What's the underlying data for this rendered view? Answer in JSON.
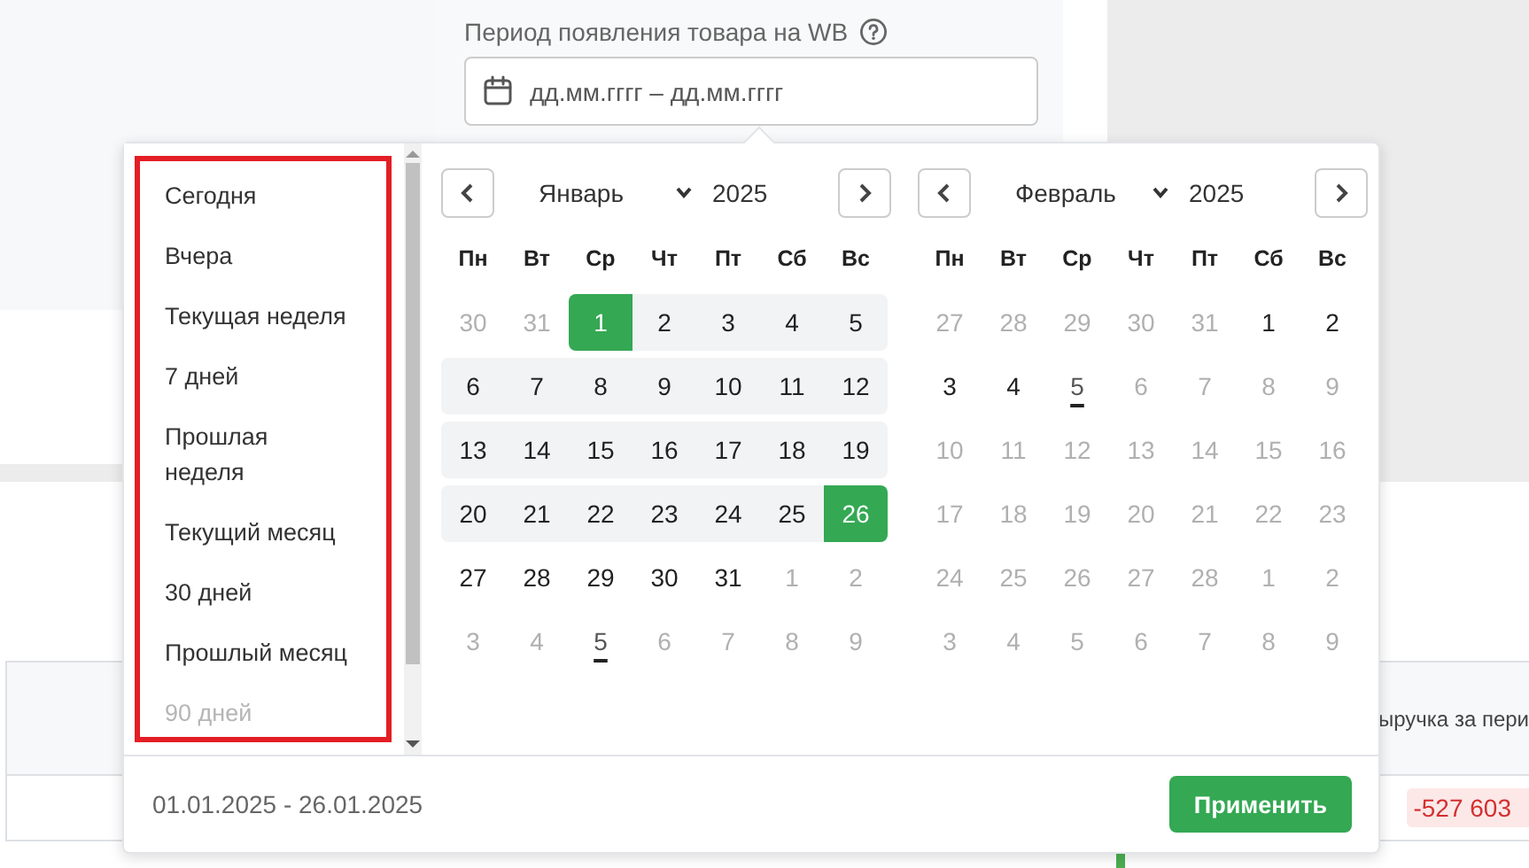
{
  "filter": {
    "label": "Период появления товара на WB",
    "field": {
      "placeholder": "дд.мм.гггг – дд.мм.гггг"
    }
  },
  "presets": [
    {
      "label": "Сегодня",
      "faded": false
    },
    {
      "label": "Вчера",
      "faded": false
    },
    {
      "label": "Текущая неделя",
      "faded": false
    },
    {
      "label": "7 дней",
      "faded": false
    },
    {
      "label": "Прошлая неделя",
      "faded": false
    },
    {
      "label": "Текущий месяц",
      "faded": false
    },
    {
      "label": "30 дней",
      "faded": false
    },
    {
      "label": "Прошлый месяц",
      "faded": false
    },
    {
      "label": "90 дней",
      "faded": true
    }
  ],
  "calendars": [
    {
      "month": "Январь",
      "year": "2025",
      "weekdays": [
        "Пн",
        "Вт",
        "Ср",
        "Чт",
        "Пт",
        "Сб",
        "Вс"
      ],
      "weeks": [
        [
          {
            "label": "30",
            "muted": true,
            "selected": false,
            "in_range": false,
            "today": false
          },
          {
            "label": "31",
            "muted": true,
            "selected": false,
            "in_range": false,
            "today": false
          },
          {
            "label": "1",
            "muted": false,
            "selected": true,
            "in_range": false,
            "today": false
          },
          {
            "label": "2",
            "muted": false,
            "selected": false,
            "in_range": true,
            "today": false
          },
          {
            "label": "3",
            "muted": false,
            "selected": false,
            "in_range": true,
            "today": false
          },
          {
            "label": "4",
            "muted": false,
            "selected": false,
            "in_range": true,
            "today": false
          },
          {
            "label": "5",
            "muted": false,
            "selected": false,
            "in_range": true,
            "today": false
          }
        ],
        [
          {
            "label": "6",
            "muted": false,
            "selected": false,
            "in_range": true,
            "today": false
          },
          {
            "label": "7",
            "muted": false,
            "selected": false,
            "in_range": true,
            "today": false
          },
          {
            "label": "8",
            "muted": false,
            "selected": false,
            "in_range": true,
            "today": false
          },
          {
            "label": "9",
            "muted": false,
            "selected": false,
            "in_range": true,
            "today": false
          },
          {
            "label": "10",
            "muted": false,
            "selected": false,
            "in_range": true,
            "today": false
          },
          {
            "label": "11",
            "muted": false,
            "selected": false,
            "in_range": true,
            "today": false
          },
          {
            "label": "12",
            "muted": false,
            "selected": false,
            "in_range": true,
            "today": false
          }
        ],
        [
          {
            "label": "13",
            "muted": false,
            "selected": false,
            "in_range": true,
            "today": false
          },
          {
            "label": "14",
            "muted": false,
            "selected": false,
            "in_range": true,
            "today": false
          },
          {
            "label": "15",
            "muted": false,
            "selected": false,
            "in_range": true,
            "today": false
          },
          {
            "label": "16",
            "muted": false,
            "selected": false,
            "in_range": true,
            "today": false
          },
          {
            "label": "17",
            "muted": false,
            "selected": false,
            "in_range": true,
            "today": false
          },
          {
            "label": "18",
            "muted": false,
            "selected": false,
            "in_range": true,
            "today": false
          },
          {
            "label": "19",
            "muted": false,
            "selected": false,
            "in_range": true,
            "today": false
          }
        ],
        [
          {
            "label": "20",
            "muted": false,
            "selected": false,
            "in_range": true,
            "today": false
          },
          {
            "label": "21",
            "muted": false,
            "selected": false,
            "in_range": true,
            "today": false
          },
          {
            "label": "22",
            "muted": false,
            "selected": false,
            "in_range": true,
            "today": false
          },
          {
            "label": "23",
            "muted": false,
            "selected": false,
            "in_range": true,
            "today": false
          },
          {
            "label": "24",
            "muted": false,
            "selected": false,
            "in_range": true,
            "today": false
          },
          {
            "label": "25",
            "muted": false,
            "selected": false,
            "in_range": true,
            "today": false
          },
          {
            "label": "26",
            "muted": false,
            "selected": true,
            "in_range": false,
            "today": false
          }
        ],
        [
          {
            "label": "27",
            "muted": false,
            "selected": false,
            "in_range": false,
            "today": false
          },
          {
            "label": "28",
            "muted": false,
            "selected": false,
            "in_range": false,
            "today": false
          },
          {
            "label": "29",
            "muted": false,
            "selected": false,
            "in_range": false,
            "today": false
          },
          {
            "label": "30",
            "muted": false,
            "selected": false,
            "in_range": false,
            "today": false
          },
          {
            "label": "31",
            "muted": false,
            "selected": false,
            "in_range": false,
            "today": false
          },
          {
            "label": "1",
            "muted": true,
            "selected": false,
            "in_range": false,
            "today": false
          },
          {
            "label": "2",
            "muted": true,
            "selected": false,
            "in_range": false,
            "today": false
          }
        ],
        [
          {
            "label": "3",
            "muted": true,
            "selected": false,
            "in_range": false,
            "today": false
          },
          {
            "label": "4",
            "muted": true,
            "selected": false,
            "in_range": false,
            "today": false
          },
          {
            "label": "5",
            "muted": true,
            "selected": false,
            "in_range": false,
            "today": true
          },
          {
            "label": "6",
            "muted": true,
            "selected": false,
            "in_range": false,
            "today": false
          },
          {
            "label": "7",
            "muted": true,
            "selected": false,
            "in_range": false,
            "today": false
          },
          {
            "label": "8",
            "muted": true,
            "selected": false,
            "in_range": false,
            "today": false
          },
          {
            "label": "9",
            "muted": true,
            "selected": false,
            "in_range": false,
            "today": false
          }
        ]
      ]
    },
    {
      "month": "Февраль",
      "year": "2025",
      "weekdays": [
        "Пн",
        "Вт",
        "Ср",
        "Чт",
        "Пт",
        "Сб",
        "Вс"
      ],
      "weeks": [
        [
          {
            "label": "27",
            "muted": true,
            "selected": false,
            "in_range": false,
            "today": false
          },
          {
            "label": "28",
            "muted": true,
            "selected": false,
            "in_range": false,
            "today": false
          },
          {
            "label": "29",
            "muted": true,
            "selected": false,
            "in_range": false,
            "today": false
          },
          {
            "label": "30",
            "muted": true,
            "selected": false,
            "in_range": false,
            "today": false
          },
          {
            "label": "31",
            "muted": true,
            "selected": false,
            "in_range": false,
            "today": false
          },
          {
            "label": "1",
            "muted": false,
            "selected": false,
            "in_range": false,
            "today": false
          },
          {
            "label": "2",
            "muted": false,
            "selected": false,
            "in_range": false,
            "today": false
          }
        ],
        [
          {
            "label": "3",
            "muted": false,
            "selected": false,
            "in_range": false,
            "today": false
          },
          {
            "label": "4",
            "muted": false,
            "selected": false,
            "in_range": false,
            "today": false
          },
          {
            "label": "5",
            "muted": false,
            "selected": false,
            "in_range": false,
            "today": true
          },
          {
            "label": "6",
            "muted": true,
            "selected": false,
            "in_range": false,
            "today": false
          },
          {
            "label": "7",
            "muted": true,
            "selected": false,
            "in_range": false,
            "today": false
          },
          {
            "label": "8",
            "muted": true,
            "selected": false,
            "in_range": false,
            "today": false
          },
          {
            "label": "9",
            "muted": true,
            "selected": false,
            "in_range": false,
            "today": false
          }
        ],
        [
          {
            "label": "10",
            "muted": true,
            "selected": false,
            "in_range": false,
            "today": false
          },
          {
            "label": "11",
            "muted": true,
            "selected": false,
            "in_range": false,
            "today": false
          },
          {
            "label": "12",
            "muted": true,
            "selected": false,
            "in_range": false,
            "today": false
          },
          {
            "label": "13",
            "muted": true,
            "selected": false,
            "in_range": false,
            "today": false
          },
          {
            "label": "14",
            "muted": true,
            "selected": false,
            "in_range": false,
            "today": false
          },
          {
            "label": "15",
            "muted": true,
            "selected": false,
            "in_range": false,
            "today": false
          },
          {
            "label": "16",
            "muted": true,
            "selected": false,
            "in_range": false,
            "today": false
          }
        ],
        [
          {
            "label": "17",
            "muted": true,
            "selected": false,
            "in_range": false,
            "today": false
          },
          {
            "label": "18",
            "muted": true,
            "selected": false,
            "in_range": false,
            "today": false
          },
          {
            "label": "19",
            "muted": true,
            "selected": false,
            "in_range": false,
            "today": false
          },
          {
            "label": "20",
            "muted": true,
            "selected": false,
            "in_range": false,
            "today": false
          },
          {
            "label": "21",
            "muted": true,
            "selected": false,
            "in_range": false,
            "today": false
          },
          {
            "label": "22",
            "muted": true,
            "selected": false,
            "in_range": false,
            "today": false
          },
          {
            "label": "23",
            "muted": true,
            "selected": false,
            "in_range": false,
            "today": false
          }
        ],
        [
          {
            "label": "24",
            "muted": true,
            "selected": false,
            "in_range": false,
            "today": false
          },
          {
            "label": "25",
            "muted": true,
            "selected": false,
            "in_range": false,
            "today": false
          },
          {
            "label": "26",
            "muted": true,
            "selected": false,
            "in_range": false,
            "today": false
          },
          {
            "label": "27",
            "muted": true,
            "selected": false,
            "in_range": false,
            "today": false
          },
          {
            "label": "28",
            "muted": true,
            "selected": false,
            "in_range": false,
            "today": false
          },
          {
            "label": "1",
            "muted": true,
            "selected": false,
            "in_range": false,
            "today": false
          },
          {
            "label": "2",
            "muted": true,
            "selected": false,
            "in_range": false,
            "today": false
          }
        ],
        [
          {
            "label": "3",
            "muted": true,
            "selected": false,
            "in_range": false,
            "today": false
          },
          {
            "label": "4",
            "muted": true,
            "selected": false,
            "in_range": false,
            "today": false
          },
          {
            "label": "5",
            "muted": true,
            "selected": false,
            "in_range": false,
            "today": false
          },
          {
            "label": "6",
            "muted": true,
            "selected": false,
            "in_range": false,
            "today": false
          },
          {
            "label": "7",
            "muted": true,
            "selected": false,
            "in_range": false,
            "today": false
          },
          {
            "label": "8",
            "muted": true,
            "selected": false,
            "in_range": false,
            "today": false
          },
          {
            "label": "9",
            "muted": true,
            "selected": false,
            "in_range": false,
            "today": false
          }
        ]
      ]
    }
  ],
  "footer": {
    "range": "01.01.2025 - 26.01.2025",
    "apply": "Применить"
  },
  "table": {
    "header_cell": "ыручка за пери",
    "value_badge": "-527 603"
  }
}
